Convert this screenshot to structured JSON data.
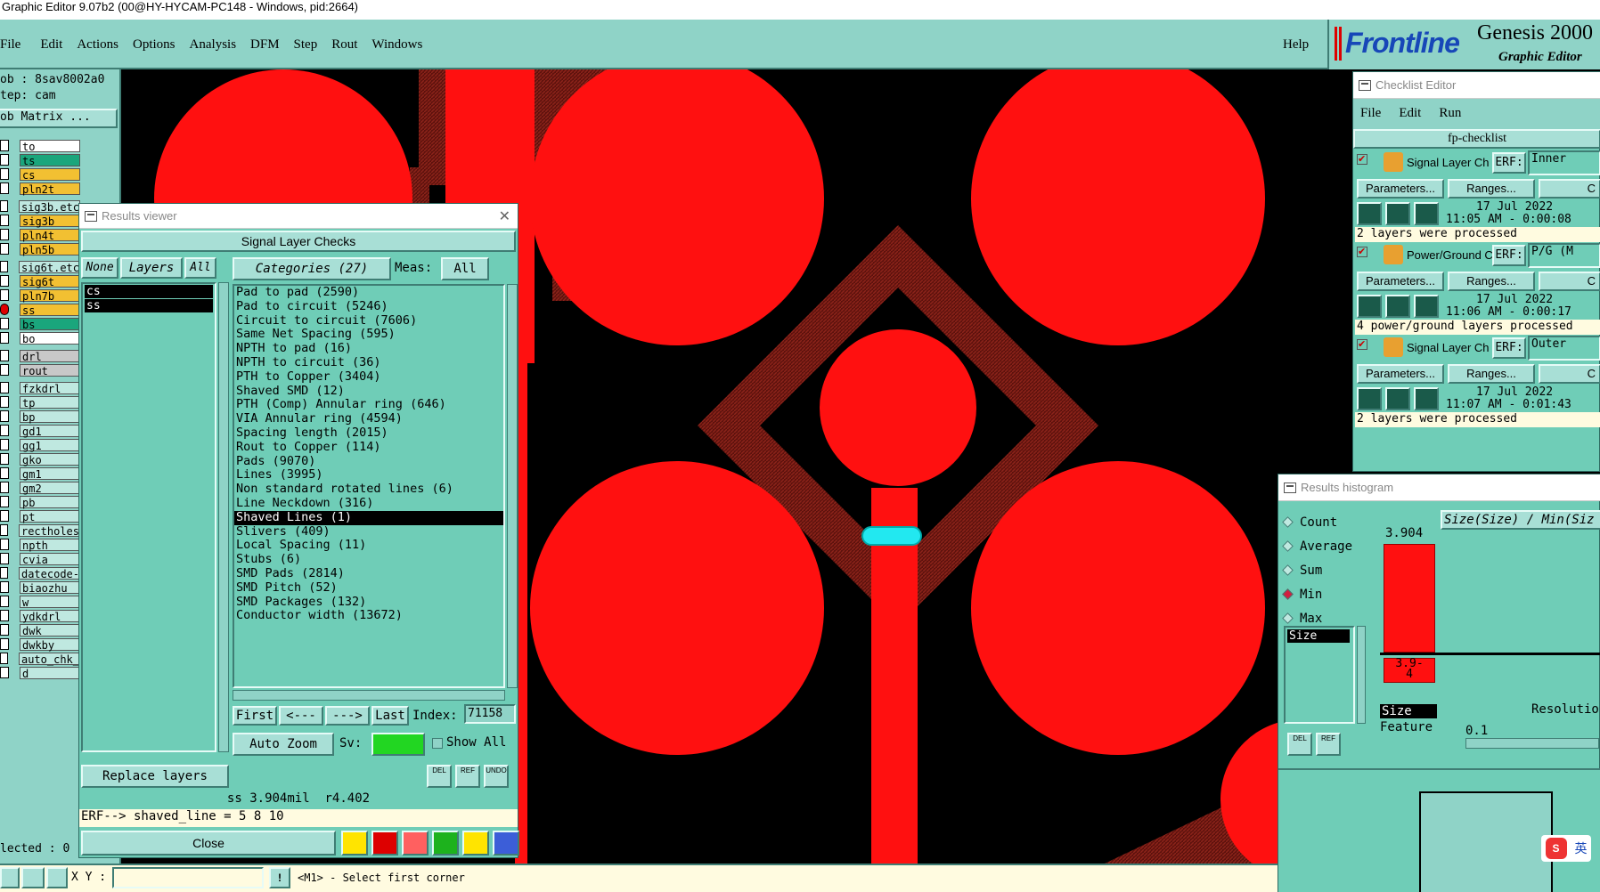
{
  "window_title": "Graphic Editor 9.07b2 (00@HY-HYCAM-PC148 - Windows, pid:2664)",
  "menu": [
    "File",
    "Edit",
    "Actions",
    "Options",
    "Analysis",
    "DFM",
    "Step",
    "Rout",
    "Windows"
  ],
  "help_label": "Help",
  "brand": {
    "logo": "Frontline",
    "product": "Genesis 2000",
    "subtitle": "Graphic Editor"
  },
  "left_panel": {
    "job_label": "ob : 8sav8002a0",
    "step_label": "tep: cam",
    "matrix_button": "ob Matrix ...",
    "layers": [
      {
        "name": "to",
        "color": "#ffffff"
      },
      {
        "name": "ts",
        "color": "#1aa67c"
      },
      {
        "name": "cs",
        "color": "#f2c032"
      },
      {
        "name": "pln2t",
        "color": "#f2c032"
      },
      {
        "name": "sig3b.etc",
        "color": "#bfe8e0"
      },
      {
        "name": "sig3b",
        "color": "#f2c032"
      },
      {
        "name": "pln4t",
        "color": "#f2c032"
      },
      {
        "name": "pln5b",
        "color": "#f2c032"
      },
      {
        "name": "sig6t.etc",
        "color": "#bfe8e0"
      },
      {
        "name": "sig6t",
        "color": "#f2c032"
      },
      {
        "name": "pln7b",
        "color": "#f2c032"
      },
      {
        "name": "ss",
        "color": "#f2c032"
      },
      {
        "name": "bs",
        "color": "#1aa67c"
      },
      {
        "name": "bo",
        "color": "#ffffff"
      },
      {
        "name": "drl",
        "color": "#c8c8c8"
      },
      {
        "name": "rout",
        "color": "#c8c8c8"
      },
      {
        "name": "fzkdrl",
        "color": "#bfe8e0"
      },
      {
        "name": "tp",
        "color": "#bfe8e0"
      },
      {
        "name": "bp",
        "color": "#bfe8e0"
      },
      {
        "name": "gd1",
        "color": "#bfe8e0"
      },
      {
        "name": "gg1",
        "color": "#bfe8e0"
      },
      {
        "name": "gko",
        "color": "#bfe8e0"
      },
      {
        "name": "gm1",
        "color": "#bfe8e0"
      },
      {
        "name": "gm2",
        "color": "#bfe8e0"
      },
      {
        "name": "pb",
        "color": "#bfe8e0"
      },
      {
        "name": "pt",
        "color": "#bfe8e0"
      },
      {
        "name": "rectholes",
        "color": "#bfe8e0"
      },
      {
        "name": "npth",
        "color": "#bfe8e0"
      },
      {
        "name": "cvia",
        "color": "#bfe8e0"
      },
      {
        "name": "datecode-",
        "color": "#bfe8e0"
      },
      {
        "name": "biaozhu",
        "color": "#bfe8e0"
      },
      {
        "name": "w",
        "color": "#bfe8e0"
      },
      {
        "name": "ydkdrl",
        "color": "#bfe8e0"
      },
      {
        "name": "dwk",
        "color": "#bfe8e0"
      },
      {
        "name": "dwkby",
        "color": "#bfe8e0"
      },
      {
        "name": "auto_chk_",
        "color": "#bfe8e0"
      },
      {
        "name": "d",
        "color": "#bfe8e0"
      }
    ],
    "selected_label": "lected : 0"
  },
  "results_viewer": {
    "title": "Results viewer",
    "header": "Signal Layer Checks",
    "none_btn": "None",
    "layers_btn": "Layers",
    "all_btn": "All",
    "layer_items": [
      "cs",
      "ss"
    ],
    "categories_btn": "Categories (27)",
    "meas_label": "Meas:",
    "meas_value": "All",
    "categories": [
      "Pad to pad (2590)",
      "Pad to circuit (5246)",
      "Circuit to circuit (7606)",
      "Same Net Spacing (595)",
      "NPTH to pad (16)",
      "NPTH to circuit (36)",
      "PTH to Copper (3404)",
      "Shaved SMD (12)",
      "PTH (Comp) Annular ring (646)",
      "VIA Annular ring (4594)",
      "Spacing length (2015)",
      "Rout to Copper (114)",
      "Pads (9070)",
      "Lines (3995)",
      "Non standard rotated lines (6)",
      "Line Neckdown (316)",
      "Shaved Lines (1)",
      "Slivers (409)",
      "Local Spacing (11)",
      "Stubs (6)",
      "SMD Pads (2814)",
      "SMD Pitch (52)",
      "SMD Packages (132)",
      "Conductor width (13672)"
    ],
    "selected_category": "Shaved Lines (1)",
    "first_btn": "First",
    "prev_btn": "<---",
    "next_btn": "--->",
    "last_btn": "Last",
    "index_label": "Index:",
    "index_value": "71158",
    "autozoom_btn": "Auto Zoom",
    "sv_label": "Sv:",
    "show_all": "Show All",
    "replace_btn": "Replace layers",
    "status_line": "ss 3.904mil  r4.402",
    "erf_line": "ERF--> shaved_line = 5 8 10",
    "close_btn": "Close",
    "small_btns": [
      "DEL",
      "REF",
      "UNDO"
    ]
  },
  "checklist": {
    "title": "Checklist Editor",
    "menu": [
      "File",
      "Edit",
      "Run"
    ],
    "name": "fp-checklist",
    "items": [
      {
        "label": "Signal Layer Ch",
        "erf": "ERF:",
        "erf_value": "Inner",
        "date": "17 Jul 2022",
        "time": "11:05 AM - 0:00:08",
        "status": "2 layers were processed"
      },
      {
        "label": "Power/Ground C",
        "erf": "ERF:",
        "erf_value": "P/G (M",
        "date": "17 Jul 2022",
        "time": "11:06 AM - 0:00:17",
        "status": "4 power/ground layers processed"
      },
      {
        "label": "Signal Layer Ch",
        "erf": "ERF:",
        "erf_value": "Outer",
        "date": "17 Jul 2022",
        "time": "11:07 AM - 0:01:43",
        "status": "2 layers were processed"
      }
    ],
    "params_btn": "Parameters...",
    "ranges_btn": "Ranges...",
    "c_btn": "C"
  },
  "histogram": {
    "title": "Results histogram",
    "options": [
      "Count",
      "Average",
      "Sum",
      "Min",
      "Max"
    ],
    "selected": "Min",
    "header": "Size(Size) / Min(Siz",
    "bar_value": "3.904",
    "bar_label": "3.9-\n4",
    "list_item": "Size",
    "size_label": "Size",
    "feature_label": "Feature",
    "resolution_label": "Resolutio",
    "resolution_value": "0.1",
    "small_btns": [
      "DEL",
      "REF"
    ]
  },
  "bottom_bar": {
    "xy_label": "X Y :",
    "xy_value": "",
    "prompt": "<M1> - Select first corner"
  },
  "ime_label": "英",
  "colors": {
    "pad": "#ff1010",
    "hatch": "#7a1a14",
    "teal": "#8fd3c7",
    "highlight": "#22e8f0"
  }
}
